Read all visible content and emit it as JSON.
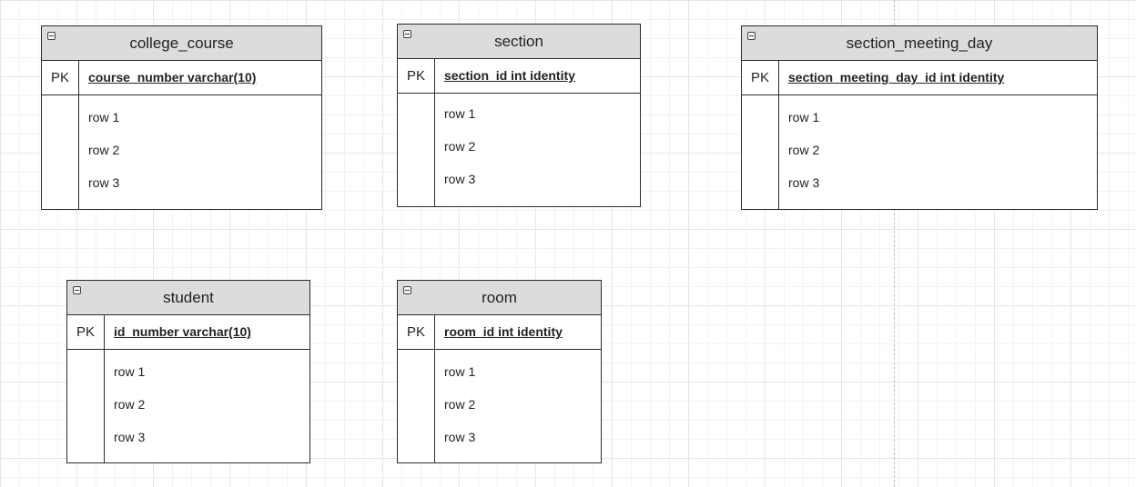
{
  "tables": [
    {
      "name": "college_course",
      "pk_label": "PK",
      "pk_field": "course_number varchar(10)",
      "rows": [
        "row 1",
        "row 2",
        "row 3"
      ]
    },
    {
      "name": "section",
      "pk_label": "PK",
      "pk_field": "section_id int identity",
      "rows": [
        "row 1",
        "row 2",
        "row 3"
      ]
    },
    {
      "name": "section_meeting_day",
      "pk_label": "PK",
      "pk_field": "section_meeting_day_id int identity",
      "rows": [
        "row 1",
        "row 2",
        "row 3"
      ]
    },
    {
      "name": "student",
      "pk_label": "PK",
      "pk_field": "id_number varchar(10)",
      "rows": [
        "row 1",
        "row 2",
        "row 3"
      ]
    },
    {
      "name": "room",
      "pk_label": "PK",
      "pk_field": "room_id int identity",
      "rows": [
        "row 1",
        "row 2",
        "row 3"
      ]
    }
  ]
}
